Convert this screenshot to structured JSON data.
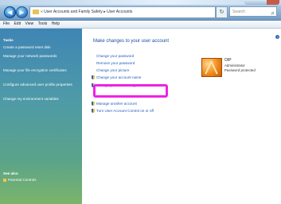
{
  "titlebar": {
    "back_glyph": "◀",
    "forward_glyph": "▶",
    "breadcrumb": "« User Accounts and Family Safety ▸ User Accounts",
    "refresh_glyph": "↻",
    "search_placeholder": "Search",
    "search_icon": "⌕"
  },
  "menu": [
    "File",
    "Edit",
    "View",
    "Tools",
    "Help"
  ],
  "sidebar": {
    "heading": "Tasks",
    "items": [
      "Create a password reset disk",
      "Manage your network passwords",
      "Manage your file encryption certificates",
      "Configure advanced user profile properties",
      "Change my environment variables"
    ],
    "see_also_heading": "See also",
    "see_also_link": "Parental Controls"
  },
  "main": {
    "title": "Make changes to your user account",
    "links": [
      "Change your password",
      "Remove your password",
      "Change your picture",
      "Change your account name",
      "Change your account type"
    ],
    "shield_links": [
      "Manage another account",
      "Turn User Account Control on or off"
    ],
    "help_glyph": "?"
  },
  "user": {
    "name": "OIP",
    "role": "Administrator",
    "status": "Password protected"
  },
  "highlight_color": "#ef22e3"
}
